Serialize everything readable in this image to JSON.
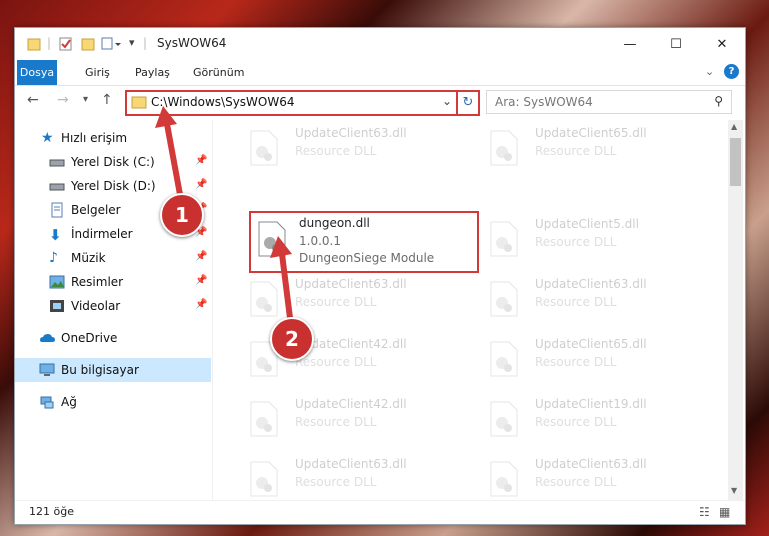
{
  "window": {
    "title": "SysWOW64",
    "controls": {
      "minimize": "—",
      "maximize": "☐",
      "close": "✕"
    }
  },
  "ribbon": {
    "tabs": [
      "Dosya",
      "Giriş",
      "Paylaş",
      "Görünüm"
    ],
    "help": "?"
  },
  "nav": {
    "address": "C:\\Windows\\SysWOW64",
    "search_placeholder": "Ara: SysWOW64"
  },
  "sidebar": {
    "quick_access": "Hızlı erişim",
    "items": [
      {
        "label": "Yerel Disk (C:)",
        "pinned": true
      },
      {
        "label": "Yerel Disk (D:)",
        "pinned": true
      },
      {
        "label": "Belgeler",
        "pinned": true
      },
      {
        "label": "İndirmeler",
        "pinned": true
      },
      {
        "label": "Müzik",
        "pinned": true
      },
      {
        "label": "Resimler",
        "pinned": true
      },
      {
        "label": "Videolar",
        "pinned": true
      }
    ],
    "onedrive": "OneDrive",
    "this_pc": "Bu bilgisayar",
    "network": "Ağ"
  },
  "files": {
    "highlighted": {
      "name": "dungeon.dll",
      "version": "1.0.0.1",
      "description": "DungeonSiege Module"
    },
    "left_column": [
      {
        "name": "UpdateClient63.dll",
        "desc": "Resource DLL"
      },
      {
        "name": "UpdateClient63.dll",
        "desc": "Resource DLL"
      },
      {
        "name": "UpdateClient42.dll",
        "desc": "Resource DLL"
      },
      {
        "name": "UpdateClient42.dll",
        "desc": "Resource DLL"
      },
      {
        "name": "UpdateClient63.dll",
        "desc": "Resource DLL"
      }
    ],
    "right_column": [
      {
        "name": "UpdateClient65.dll",
        "desc": "Resource DLL"
      },
      {
        "name": "UpdateClient5.dll",
        "desc": "Resource DLL"
      },
      {
        "name": "UpdateClient63.dll",
        "desc": "Resource DLL"
      },
      {
        "name": "UpdateClient65.dll",
        "desc": "Resource DLL"
      },
      {
        "name": "UpdateClient19.dll",
        "desc": "Resource DLL"
      },
      {
        "name": "UpdateClient63.dll",
        "desc": "Resource DLL"
      }
    ]
  },
  "status": {
    "count": "121 öğe"
  },
  "annotations": {
    "badge1": "1",
    "badge2": "2"
  },
  "colors": {
    "accent": "#1979ca",
    "highlight": "#d23a3a",
    "selected": "#cce8ff"
  }
}
